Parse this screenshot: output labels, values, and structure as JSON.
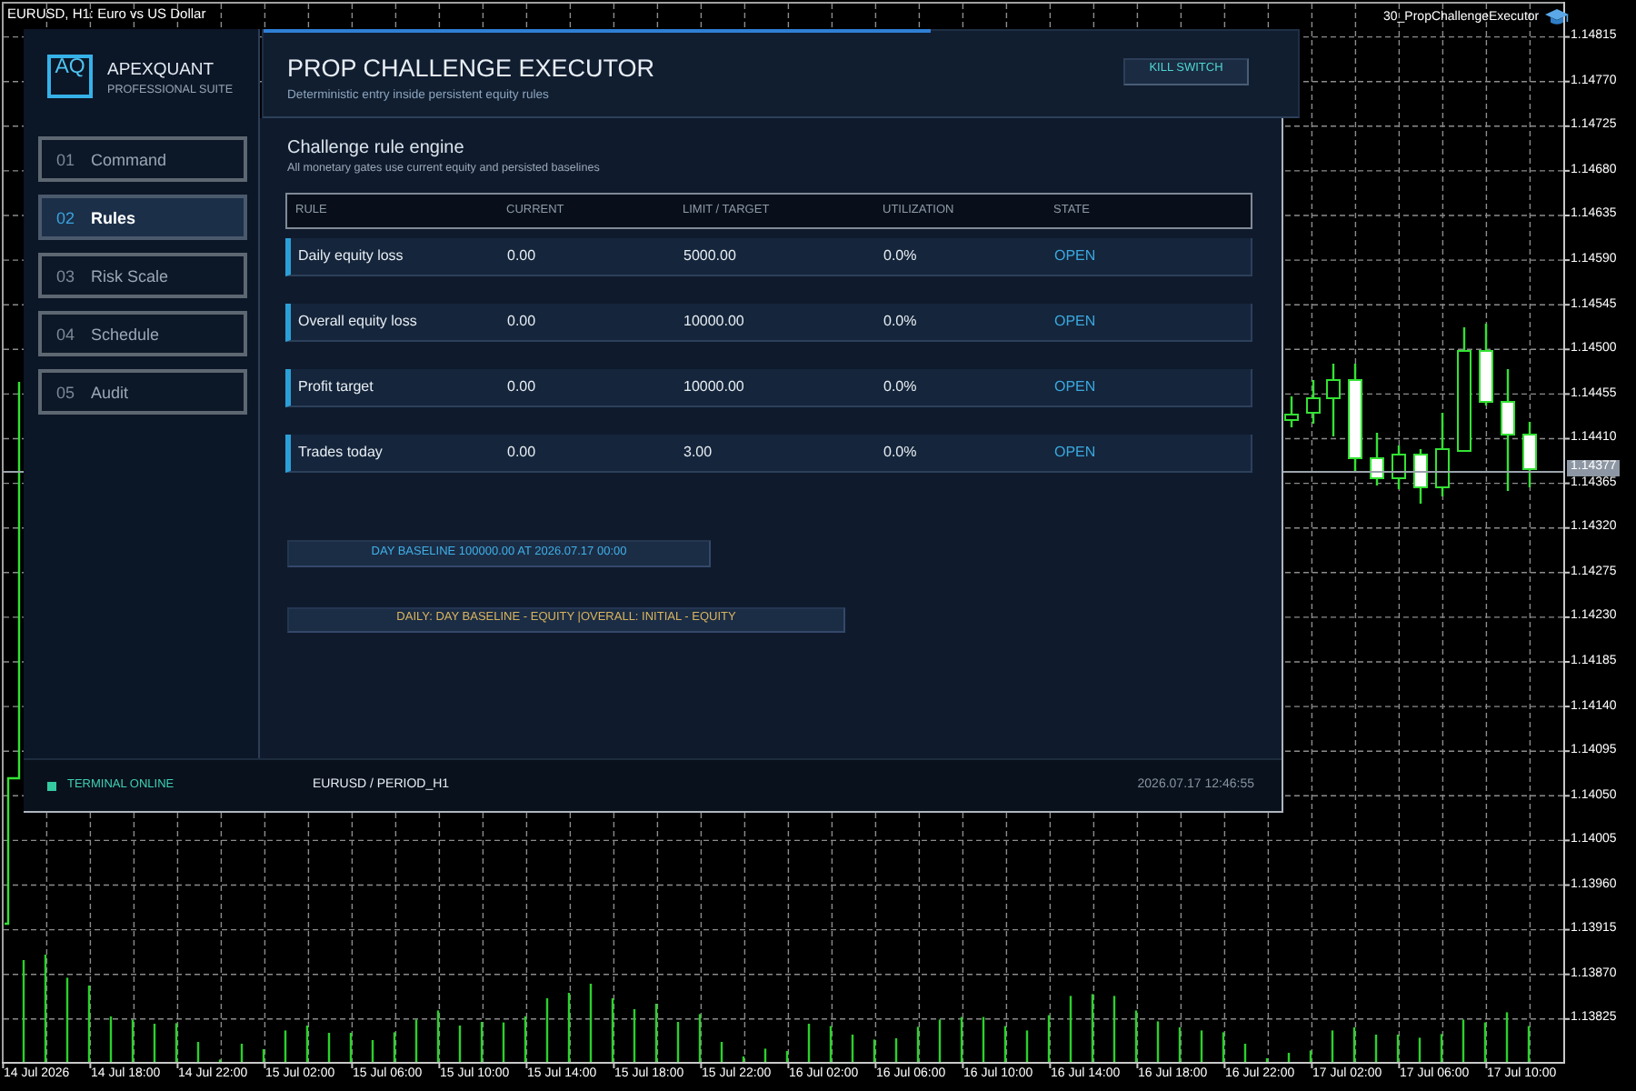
{
  "chart": {
    "title": "EURUSD, H1: Euro vs US Dollar",
    "expert": "30_PropChallengeExecutor",
    "price_labels": [
      "1.14815",
      "1.14770",
      "1.14725",
      "1.14680",
      "1.14635",
      "1.14590",
      "1.14545",
      "1.14500",
      "1.14455",
      "1.14410",
      "1.14365",
      "1.14320",
      "1.14275",
      "1.14230",
      "1.14185",
      "1.14140",
      "1.14095",
      "1.14050",
      "1.14005",
      "1.13960",
      "1.13915",
      "1.13870",
      "1.13825"
    ],
    "current_price": "1.14377",
    "time_labels": [
      "14 Jul 2026",
      "14 Jul 18:00",
      "14 Jul 22:00",
      "15 Jul 02:00",
      "15 Jul 06:00",
      "15 Jul 10:00",
      "15 Jul 14:00",
      "15 Jul 18:00",
      "15 Jul 22:00",
      "16 Jul 02:00",
      "16 Jul 06:00",
      "16 Jul 10:00",
      "16 Jul 14:00",
      "16 Jul 18:00",
      "16 Jul 22:00",
      "17 Jul 02:00",
      "17 Jul 06:00",
      "17 Jul 10:00"
    ]
  },
  "panel": {
    "brand": {
      "logo": "AQ",
      "name": "APEXQUANT",
      "tagline": "PROFESSIONAL SUITE"
    },
    "nav": [
      {
        "number": "01",
        "label": "Command",
        "selected": false
      },
      {
        "number": "02",
        "label": "Rules",
        "selected": true
      },
      {
        "number": "03",
        "label": "Risk Scale",
        "selected": false
      },
      {
        "number": "04",
        "label": "Schedule",
        "selected": false
      },
      {
        "number": "05",
        "label": "Audit",
        "selected": false
      }
    ],
    "header": {
      "title": "PROP CHALLENGE EXECUTOR",
      "subtitle": "Deterministic entry inside persistent equity rules",
      "kill_switch": "KILL SWITCH"
    },
    "section": {
      "title": "Challenge rule engine",
      "subtitle": "All monetary gates use current equity and persisted baselines"
    },
    "table": {
      "columns": [
        "RULE",
        "CURRENT",
        "LIMIT / TARGET",
        "UTILIZATION",
        "STATE"
      ],
      "rows": [
        {
          "rule": "Daily equity loss",
          "current": "0.00",
          "limit": "5000.00",
          "utilization": "0.0%",
          "state": "OPEN"
        },
        {
          "rule": "Overall equity loss",
          "current": "0.00",
          "limit": "10000.00",
          "utilization": "0.0%",
          "state": "OPEN"
        },
        {
          "rule": "Profit target",
          "current": "0.00",
          "limit": "10000.00",
          "utilization": "0.0%",
          "state": "OPEN"
        },
        {
          "rule": "Trades today",
          "current": "0.00",
          "limit": "3.00",
          "utilization": "0.0%",
          "state": "OPEN"
        }
      ]
    },
    "banners": [
      {
        "text": "DAY BASELINE 100000.00 AT 2026.07.17 00:00",
        "color": "#3fb0e6"
      },
      {
        "text": "DAILY: DAY BASELINE - EQUITY |OVERALL: INITIAL - EQUITY",
        "color": "#d9b45e"
      }
    ],
    "status_bar": {
      "connection": "TERMINAL ONLINE",
      "online": true,
      "symbol": "EURUSD / PERIOD_H1",
      "time": "2026.07.17 12:46:55"
    }
  }
}
